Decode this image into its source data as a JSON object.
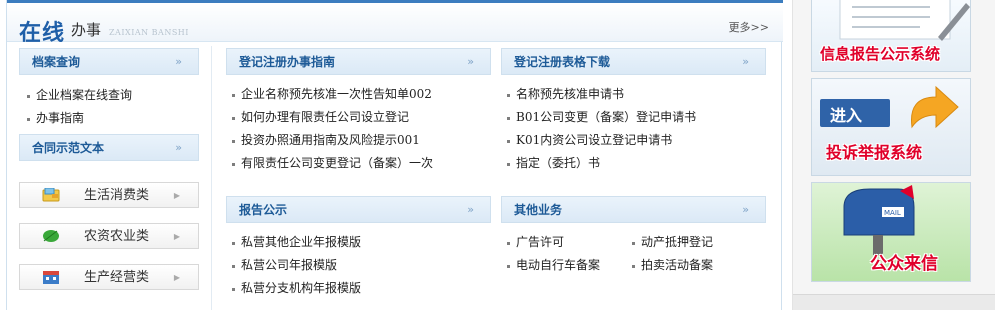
{
  "header": {
    "title_big": "在线",
    "title_small": "办事",
    "title_pinyin": "ZAIXIAN BANSHI",
    "more_link": "更多>>"
  },
  "chevron_glyph": "》",
  "left": {
    "archive": {
      "heading": "档案查询",
      "items": [
        "企业档案在线查询",
        "办事指南"
      ]
    },
    "contract": {
      "heading": "合同示范文本",
      "categories": [
        {
          "label": "生活消费类",
          "icon": "wallet-icon"
        },
        {
          "label": "农资农业类",
          "icon": "leaf-icon"
        },
        {
          "label": "生产经营类",
          "icon": "factory-icon"
        }
      ]
    }
  },
  "guide": {
    "heading": "登记注册办事指南",
    "items": [
      "企业名称预先核准一次性告知单002",
      "如何办理有限责任公司设立登记",
      "投资办照通用指南及风险提示001",
      "有限责任公司变更登记（备案）一次"
    ]
  },
  "forms": {
    "heading": "登记注册表格下载",
    "items": [
      "名称预先核准申请书",
      "B01公司变更（备案）登记申请书",
      "K01内资公司设立登记申请书",
      "指定（委托）书"
    ]
  },
  "report": {
    "heading": "报告公示",
    "items": [
      "私营其他企业年报模版",
      "私营公司年报模版",
      "私营分支机构年报模版"
    ]
  },
  "other": {
    "heading": "其他业务",
    "items_left": [
      "广告许可",
      "电动自行车备案"
    ],
    "items_right": [
      "动产抵押登记",
      "拍卖活动备案"
    ]
  },
  "banners": {
    "info_report": "信息报告公示系统",
    "complaint_enter": "进入",
    "complaint": "投诉举报系统",
    "public_letter": "公众来信",
    "mail_label": "MAIL"
  },
  "colors": {
    "accent": "#1f5fa8",
    "banner_red": "#e0002a",
    "orange_arrow": "#f5a623"
  }
}
